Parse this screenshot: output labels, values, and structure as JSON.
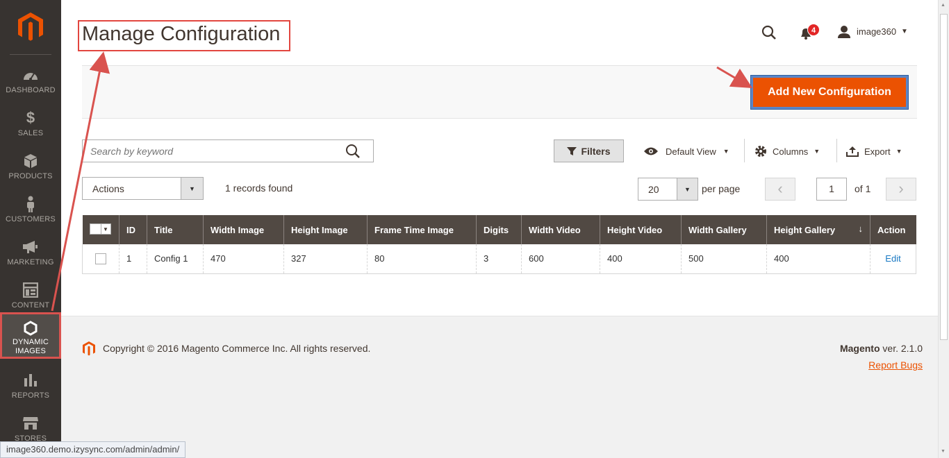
{
  "sidebar": {
    "items": [
      {
        "label": "DASHBOARD",
        "icon": "speedometer-icon"
      },
      {
        "label": "SALES",
        "icon": "dollar-icon"
      },
      {
        "label": "PRODUCTS",
        "icon": "cube-icon"
      },
      {
        "label": "CUSTOMERS",
        "icon": "person-icon"
      },
      {
        "label": "MARKETING",
        "icon": "megaphone-icon"
      },
      {
        "label": "CONTENT",
        "icon": "layout-icon"
      },
      {
        "label": "DYNAMIC IMAGES",
        "icon": "hexagon-icon",
        "active": true
      },
      {
        "label": "REPORTS",
        "icon": "bar-chart-icon"
      },
      {
        "label": "STORES",
        "icon": "storefront-icon"
      }
    ]
  },
  "header": {
    "page_title": "Manage Configuration",
    "notification_count": "4",
    "username": "image360"
  },
  "action_bar": {
    "add_button_label": "Add New Configuration"
  },
  "toolbar": {
    "search_placeholder": "Search by keyword",
    "filters_label": "Filters",
    "view_label": "Default View",
    "columns_label": "Columns",
    "export_label": "Export",
    "actions_label": "Actions",
    "records_found": "1 records found",
    "per_page_value": "20",
    "per_page_label": "per page",
    "current_page": "1",
    "page_total": "of 1"
  },
  "grid": {
    "columns": [
      "ID",
      "Title",
      "Width Image",
      "Height Image",
      "Frame Time Image",
      "Digits",
      "Width Video",
      "Height Video",
      "Width Gallery",
      "Height Gallery",
      "Action"
    ],
    "sort_indicator": "↓",
    "rows": [
      {
        "id": "1",
        "title": "Config 1",
        "width_image": "470",
        "height_image": "327",
        "frame_time_image": "80",
        "digits": "3",
        "width_video": "600",
        "height_video": "400",
        "width_gallery": "500",
        "height_gallery": "400",
        "action": "Edit"
      }
    ]
  },
  "footer": {
    "copyright": "Copyright © 2016 Magento Commerce Inc. All rights reserved.",
    "brand": "Magento",
    "version": " ver. 2.1.0",
    "report_bugs": "Report Bugs"
  },
  "statusbar": {
    "url": "image360.demo.izysync.com/admin/admin/"
  },
  "colors": {
    "sidebar_bg": "#373330",
    "accent_orange": "#eb5202",
    "grid_header": "#514943",
    "annotation_red": "#e2463f"
  }
}
